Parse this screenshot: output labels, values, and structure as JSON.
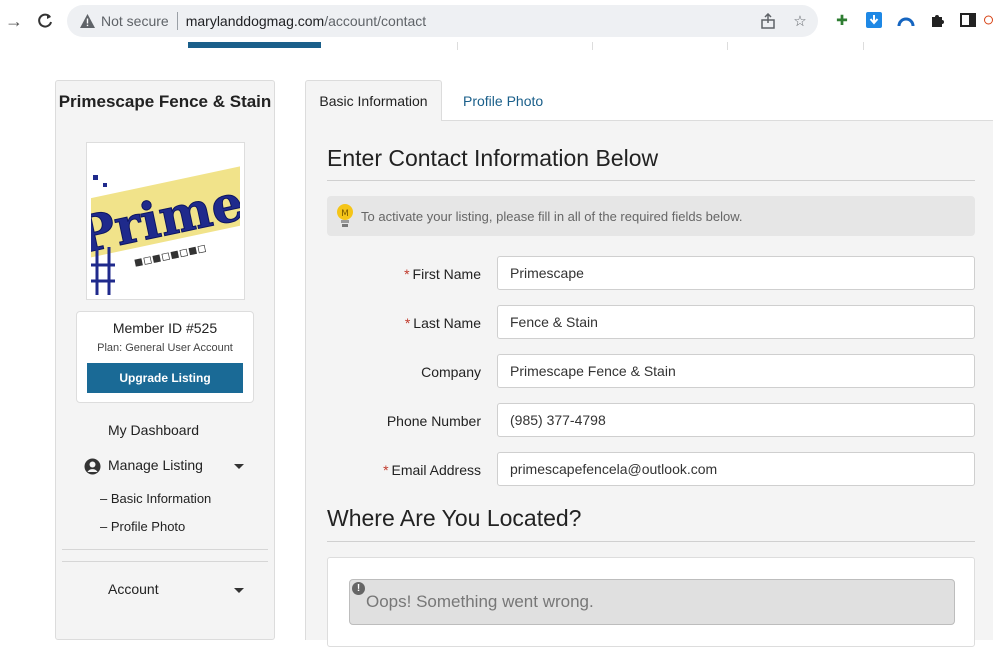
{
  "browser": {
    "not_secure": "Not secure",
    "url_host": "marylanddogmag.com",
    "url_path": "/account/contact"
  },
  "sidebar": {
    "business_name": "Primescape Fence & Stain",
    "logo_text": "PrimeScap",
    "member_id": "Member ID #525",
    "plan": "Plan: General User Account",
    "upgrade_label": "Upgrade Listing",
    "dashboard": "My Dashboard",
    "manage_listing": "Manage Listing",
    "sub_basic": "– Basic Information",
    "sub_photo": "– Profile Photo",
    "account": "Account"
  },
  "tabs": {
    "basic": "Basic Information",
    "photo": "Profile Photo"
  },
  "form": {
    "title": "Enter Contact Information Below",
    "notice": "To activate your listing, please fill in all of the required fields below.",
    "required_mark": "*",
    "fields": [
      {
        "label": "First Name",
        "value": "Primescape",
        "required": true
      },
      {
        "label": "Last Name",
        "value": "Fence & Stain",
        "required": true
      },
      {
        "label": "Company",
        "value": "Primescape Fence & Stain",
        "required": false
      },
      {
        "label": "Phone Number",
        "value": "(985) 377-4798",
        "required": false
      },
      {
        "label": "Email Address",
        "value": "primescapefencela@outlook.com",
        "required": true
      }
    ],
    "location_title": "Where Are You Located?",
    "map_error": "Oops! Something went wrong."
  },
  "colors": {
    "accent": "#1a6a96",
    "required": "#c0392b"
  }
}
